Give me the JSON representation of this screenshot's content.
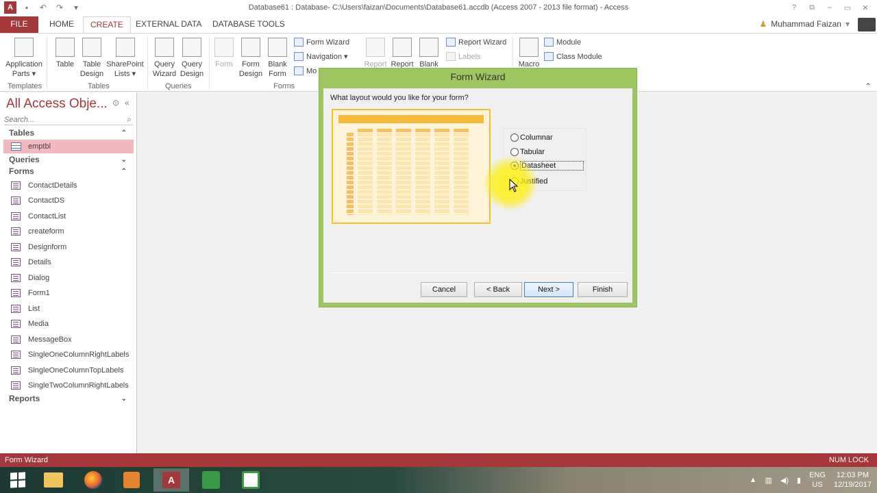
{
  "window": {
    "title": "Database61 : Database- C:\\Users\\faizan\\Documents\\Database61.accdb (Access 2007 - 2013 file format) - Access",
    "app_letter": "A",
    "controls": [
      "?",
      "⧉",
      "–",
      "▭",
      "✕"
    ]
  },
  "ribbon_tabs": {
    "file": "FILE",
    "home": "HOME",
    "create": "CREATE",
    "external": "EXTERNAL DATA",
    "tools": "DATABASE TOOLS"
  },
  "user": {
    "name": "Muhammad Faizan"
  },
  "ribbon": {
    "templates": {
      "app_parts_1": "Application",
      "app_parts_2": "Parts ▾",
      "group": "Templates"
    },
    "tables": {
      "table": "Table",
      "table_design_1": "Table",
      "table_design_2": "Design",
      "sharepoint_1": "SharePoint",
      "sharepoint_2": "Lists ▾",
      "group": "Tables"
    },
    "queries": {
      "qw_1": "Query",
      "qw_2": "Wizard",
      "qd_1": "Query",
      "qd_2": "Design",
      "group": "Queries"
    },
    "forms": {
      "form": "Form",
      "fd_1": "Form",
      "fd_2": "Design",
      "bf_1": "Blank",
      "bf_2": "Form",
      "form_wizard": "Form Wizard",
      "navigation": "Navigation ▾",
      "more": "Mo",
      "group": "Forms"
    },
    "reports": {
      "report_dis": "Report",
      "report": "Report",
      "blank": "Blank",
      "report_wizard": "Report Wizard",
      "labels": "Labels"
    },
    "macros": {
      "macro": "Macro",
      "module": "Module",
      "class_module": "Class Module"
    }
  },
  "nav": {
    "title": "All Access Obje...",
    "search_placeholder": "Search...",
    "sections": {
      "tables": "Tables",
      "queries": "Queries",
      "forms": "Forms",
      "reports": "Reports"
    },
    "tables": [
      "emptbl"
    ],
    "forms": [
      "ContactDetails",
      "ContactDS",
      "ContactList",
      "createform",
      "Designform",
      "Details",
      "Dialog",
      "Form1",
      "List",
      "Media",
      "MessageBox",
      "SingleOneColumnRightLabels",
      "SingleOneColumnTopLabels",
      "SingleTwoColumnRightLabels"
    ]
  },
  "dialog": {
    "title": "Form Wizard",
    "question": "What layout would you like for your form?",
    "options": [
      "Columnar",
      "Tabular",
      "Datasheet",
      "Justified"
    ],
    "selected": "Datasheet",
    "buttons": {
      "cancel": "Cancel",
      "back": "< Back",
      "next": "Next >",
      "finish": "Finish"
    }
  },
  "status": {
    "left": "Form Wizard",
    "right": "NUM LOCK"
  },
  "taskbar": {
    "lang_1": "ENG",
    "lang_2": "US",
    "time": "12:03 PM",
    "date": "12/19/2017"
  },
  "colors": {
    "accent": "#a4373a",
    "dialog_frame": "#9cc760",
    "preview_border": "#f3c12e"
  }
}
